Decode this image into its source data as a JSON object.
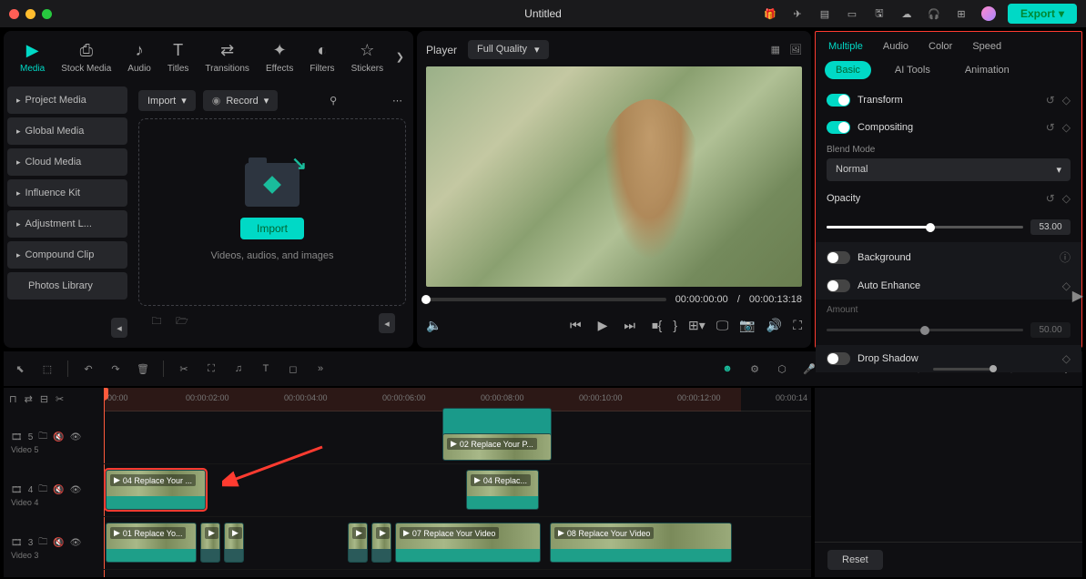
{
  "titlebar": {
    "title": "Untitled",
    "export": "Export"
  },
  "tabs": {
    "media": "Media",
    "stock": "Stock Media",
    "audio": "Audio",
    "titles": "Titles",
    "transitions": "Transitions",
    "effects": "Effects",
    "filters": "Filters",
    "stickers": "Stickers"
  },
  "import_dd": "Import",
  "record_dd": "Record",
  "sidebar": {
    "items": [
      "Project Media",
      "Global Media",
      "Cloud Media",
      "Influence Kit",
      "Adjustment L...",
      "Compound Clip",
      "Photos Library"
    ]
  },
  "dropzone": {
    "import_btn": "Import",
    "hint": "Videos, audios, and images"
  },
  "player": {
    "label": "Player",
    "quality": "Full Quality",
    "time_current": "00:00:00:00",
    "time_sep": "/",
    "time_total": "00:00:13:18"
  },
  "props": {
    "tabs": {
      "multiple": "Multiple",
      "audio": "Audio",
      "color": "Color",
      "speed": "Speed"
    },
    "sub": {
      "basic": "Basic",
      "ai": "AI Tools",
      "anim": "Animation"
    },
    "transform": "Transform",
    "compositing": "Compositing",
    "blend_label": "Blend Mode",
    "blend_value": "Normal",
    "opacity": "Opacity",
    "opacity_val": "53.00",
    "background": "Background",
    "auto_enhance": "Auto Enhance",
    "amount": "Amount",
    "amount_val": "50.00",
    "drop_shadow": "Drop Shadow",
    "reset": "Reset"
  },
  "ruler": {
    "ticks": [
      "00:00",
      "00:00:02:00",
      "00:00:04:00",
      "00:00:06:00",
      "00:00:08:00",
      "00:00:10:00",
      "00:00:12:00",
      "00:00:14"
    ]
  },
  "tracks": {
    "v5": {
      "num": "5",
      "name": "Video 5"
    },
    "v4": {
      "num": "4",
      "name": "Video 4"
    },
    "v3": {
      "num": "3",
      "name": "Video 3"
    }
  },
  "clips": {
    "c02": "02 Replace Your P...",
    "c04": "04 Replace Your ...",
    "c04b": "04 Replac...",
    "c01": "01 Replace Yo...",
    "c07": "07 Replace Your Video",
    "c08": "08 Replace Your Video"
  }
}
